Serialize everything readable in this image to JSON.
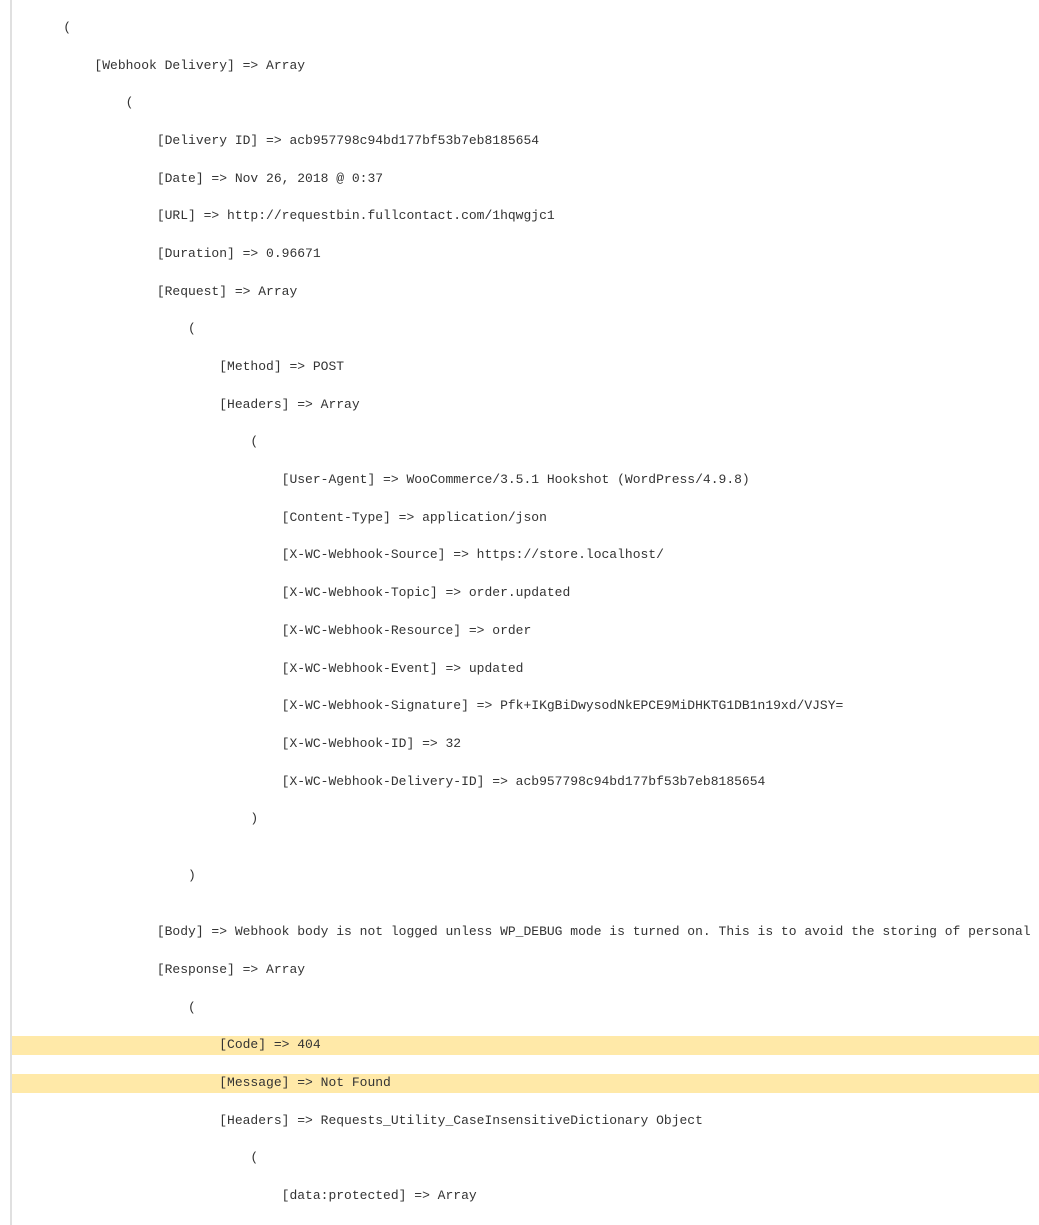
{
  "log": {
    "indent0": "    (",
    "webhook_delivery": "        [Webhook Delivery] => Array",
    "paren1_open": "            (",
    "delivery_id": "                [Delivery ID] => acb957798c94bd177bf53b7eb8185654",
    "date": "                [Date] => Nov 26, 2018 @ 0:37",
    "url": "                [URL] => http://requestbin.fullcontact.com/1hqwgjc1",
    "duration": "                [Duration] => 0.96671",
    "request": "                [Request] => Array",
    "paren2_open": "                    (",
    "method": "                        [Method] => POST",
    "headers": "                        [Headers] => Array",
    "paren3_open": "                            (",
    "user_agent": "                                [User-Agent] => WooCommerce/3.5.1 Hookshot (WordPress/4.9.8)",
    "content_type": "                                [Content-Type] => application/json",
    "webhook_source": "                                [X-WC-Webhook-Source] => https://store.localhost/",
    "webhook_topic": "                                [X-WC-Webhook-Topic] => order.updated",
    "webhook_resource": "                                [X-WC-Webhook-Resource] => order",
    "webhook_event": "                                [X-WC-Webhook-Event] => updated",
    "webhook_signature": "                                [X-WC-Webhook-Signature] => Pfk+IKgBiDwysodNkEPCE9MiDHKTG1DB1n19xd/VJSY=",
    "webhook_id": "                                [X-WC-Webhook-ID] => 32",
    "webhook_delivery_id": "                                [X-WC-Webhook-Delivery-ID] => acb957798c94bd177bf53b7eb8185654",
    "paren3_close": "                            )",
    "blank1": "",
    "paren2_close": "                    )",
    "blank2": "",
    "body": "                [Body] => Webhook body is not logged unless WP_DEBUG mode is turned on. This is to avoid the storing of personal logs.",
    "response": "                [Response] => Array",
    "paren4_open": "                    (",
    "code": "                        [Code] => 404",
    "message": "                        [Message] => Not Found",
    "resp_headers": "                        [Headers] => Requests_Utility_CaseInsensitiveDictionary Object",
    "paren5_open": "                            (",
    "truncated": "                                [data:protected] => Array"
  }
}
